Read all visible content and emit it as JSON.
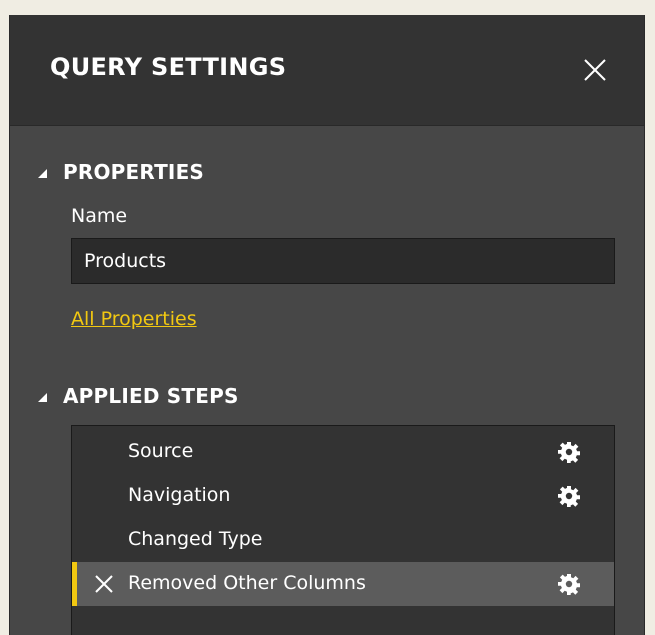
{
  "panel": {
    "title": "QUERY SETTINGS",
    "close_icon": "close-icon"
  },
  "properties": {
    "header": "PROPERTIES",
    "name_label": "Name",
    "name_value": "Products",
    "all_properties_link": "All Properties"
  },
  "applied_steps": {
    "header": "APPLIED STEPS",
    "steps": [
      {
        "label": "Source",
        "has_settings": true,
        "selected": false
      },
      {
        "label": "Navigation",
        "has_settings": true,
        "selected": false
      },
      {
        "label": "Changed Type",
        "has_settings": false,
        "selected": false
      },
      {
        "label": "Removed Other Columns",
        "has_settings": true,
        "selected": true
      }
    ]
  },
  "colors": {
    "accent": "#f2c811",
    "panel_bg": "#474747",
    "header_bg": "#333333",
    "list_bg": "#333333",
    "selected_bg": "#5c5c5c"
  }
}
